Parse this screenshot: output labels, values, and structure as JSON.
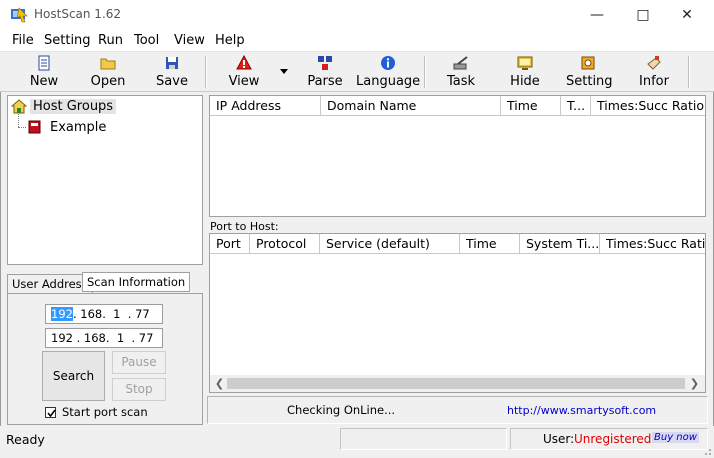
{
  "window": {
    "title": "HostScan 1.62"
  },
  "menu": {
    "items": [
      "File",
      "Setting",
      "Run",
      "Tool",
      "View",
      "Help"
    ]
  },
  "toolbar": {
    "new": "New",
    "open": "Open",
    "save": "Save",
    "view": "View",
    "parse": "Parse",
    "language": "Language",
    "task": "Task",
    "hide": "Hide",
    "setting": "Setting",
    "infor": "Infor"
  },
  "tree": {
    "root": "Host Groups",
    "child": "Example"
  },
  "host_table": {
    "columns": [
      "IP Address",
      "Domain Name",
      "Time",
      "T...",
      "Times:Succ Ratio"
    ]
  },
  "port_table": {
    "caption": "Port to Host:",
    "columns": [
      "Port",
      "Protocol",
      "Service (default)",
      "Time",
      "System Ti...",
      "Times:Succ Ratio"
    ]
  },
  "tabs": {
    "user_address": "User Address",
    "scan_information": "Scan Information"
  },
  "scan": {
    "ip_start": {
      "o1": "192",
      "rest": ". 168.  1  . 77"
    },
    "ip_end": "192 . 168.  1  . 77",
    "search": "Search",
    "pause": "Pause",
    "stop": "Stop",
    "start_port_scan": "Start port scan"
  },
  "info": {
    "checking": "Checking OnLine...",
    "url": "http://www.smartysoft.com"
  },
  "status": {
    "ready": "Ready",
    "user_label": "User:",
    "user_value": "Unregistered",
    "buy_now": "Buy now",
    "colors": {
      "unregistered": "#e00000",
      "link": "#0000cc"
    }
  }
}
